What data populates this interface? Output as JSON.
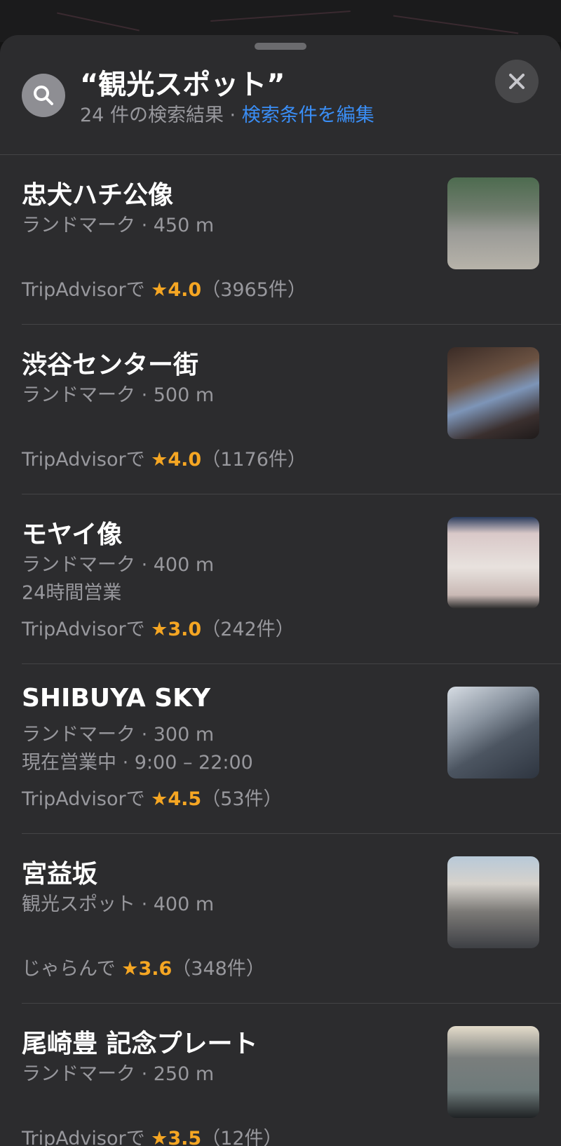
{
  "header": {
    "title": "“観光スポット”",
    "result_count": "24 件の検索結果",
    "separator": " · ",
    "edit_link": "検索条件を編集"
  },
  "results": [
    {
      "name": "忠犬ハチ公像",
      "meta": "ランドマーク · 450 m",
      "hours": "",
      "rating_source": "TripAdvisorで ",
      "rating_stars": "★4.0",
      "rating_count": "（3965件）",
      "photo_icon": "photo-thumbnail"
    },
    {
      "name": "渋谷センター街",
      "meta": "ランドマーク · 500 m",
      "hours": "",
      "rating_source": "TripAdvisorで ",
      "rating_stars": "★4.0",
      "rating_count": "（1176件）",
      "photo_icon": "photo-thumbnail"
    },
    {
      "name": "モヤイ像",
      "meta": "ランドマーク · 400 m",
      "hours": "24時間営業",
      "rating_source": "TripAdvisorで ",
      "rating_stars": "★3.0",
      "rating_count": "（242件）",
      "photo_icon": "photo-thumbnail"
    },
    {
      "name": "SHIBUYA SKY",
      "meta": "ランドマーク · 300 m",
      "hours": "現在営業中 · 9:00 – 22:00",
      "rating_source": "TripAdvisorで ",
      "rating_stars": "★4.5",
      "rating_count": "（53件）",
      "photo_icon": "photo-thumbnail"
    },
    {
      "name": "宮益坂",
      "meta": "観光スポット · 400 m",
      "hours": "",
      "rating_source": "じゃらんで ",
      "rating_stars": "★3.6",
      "rating_count": "（348件）",
      "photo_icon": "photo-thumbnail"
    },
    {
      "name": "尾崎豊 記念プレート",
      "meta": "ランドマーク · 250 m",
      "hours": "",
      "rating_source": "TripAdvisorで ",
      "rating_stars": "★3.5",
      "rating_count": "（12件）",
      "photo_icon": "photo-thumbnail"
    }
  ],
  "colors": {
    "sheet_background": "#2c2c2e",
    "link": "#3a8ef6",
    "star": "#f5a623",
    "secondary_text": "#98989d"
  },
  "icons": {
    "search": "search-icon",
    "close": "close-icon"
  }
}
